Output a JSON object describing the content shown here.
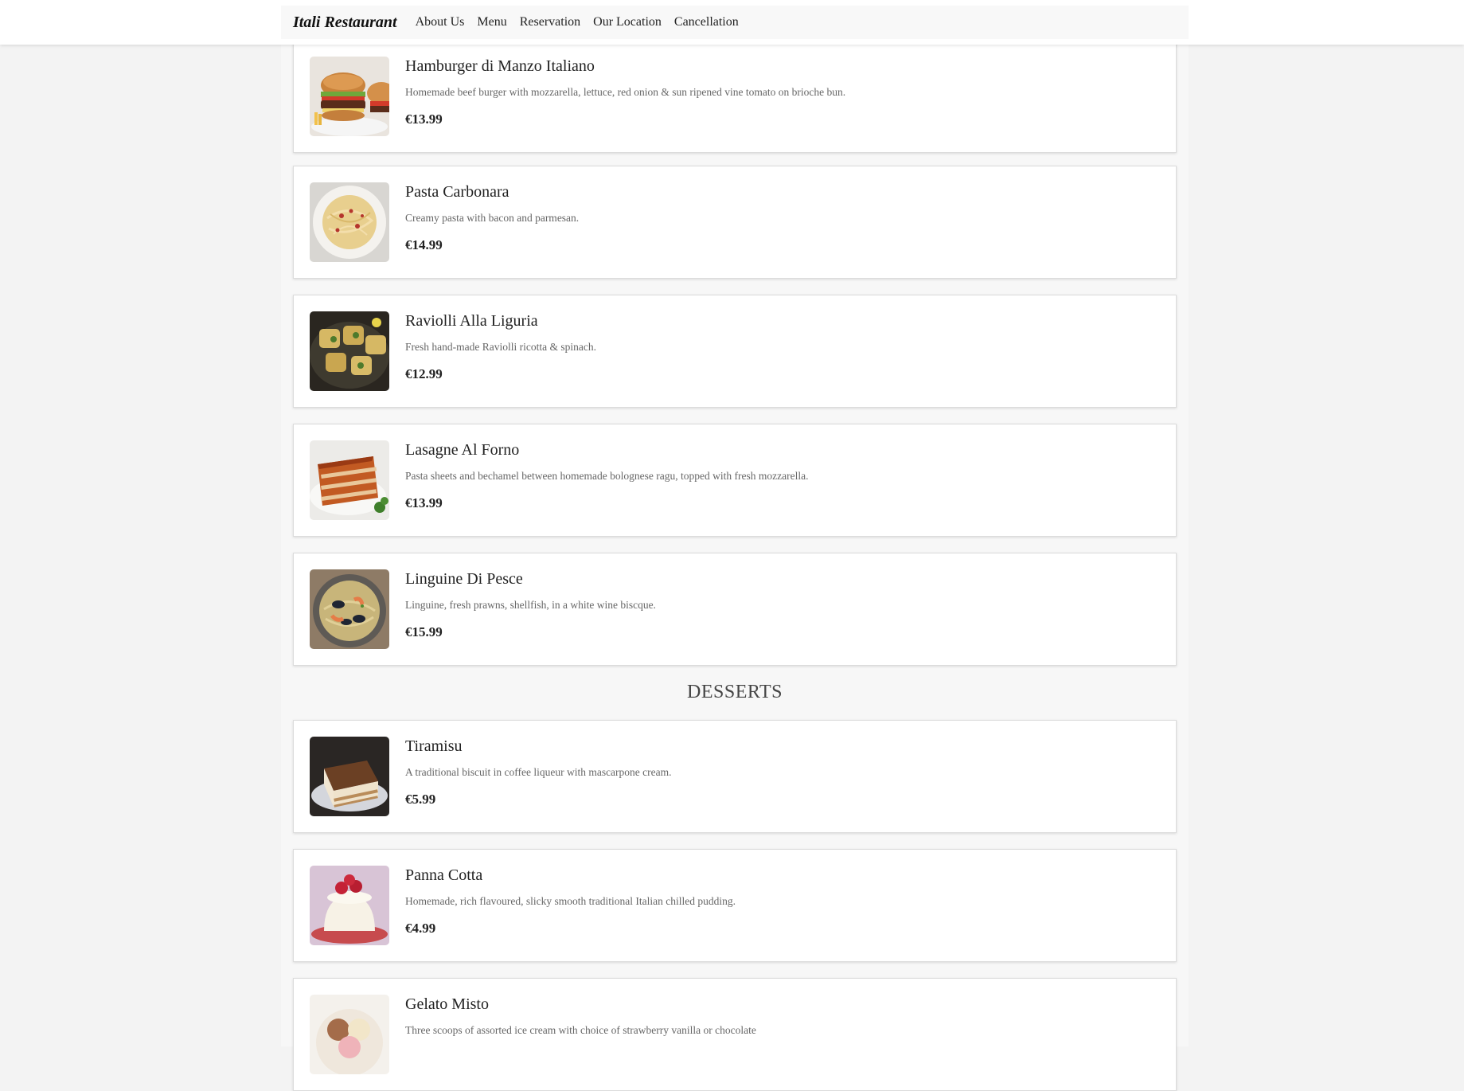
{
  "nav": {
    "brand": "Itali Restaurant",
    "links": [
      "About Us",
      "Menu",
      "Reservation",
      "Our Location",
      "Cancellation"
    ]
  },
  "mains": [
    {
      "name": "Hamburger di Manzo Italiano",
      "description": "Homemade beef burger with mozzarella, lettuce, red onion & sun ripened vine tomato on brioche bun.",
      "price": "€13.99",
      "image": "burger-image"
    },
    {
      "name": "Pasta Carbonara",
      "description": "Creamy pasta with bacon and parmesan.",
      "price": "€14.99",
      "image": "carbonara-image"
    },
    {
      "name": "Raviolli Alla Liguria",
      "description": "Fresh hand-made Raviolli ricotta & spinach.",
      "price": "€12.99",
      "image": "ravioli-image"
    },
    {
      "name": "Lasagne Al Forno",
      "description": "Pasta sheets and bechamel between homemade bolognese ragu, topped with fresh mozzarella.",
      "price": "€13.99",
      "image": "lasagne-image"
    },
    {
      "name": "Linguine Di Pesce",
      "description": "Linguine, fresh prawns, shellfish, in a white wine biscque.",
      "price": "€15.99",
      "image": "linguine-image"
    }
  ],
  "desserts_heading": "DESSERTS",
  "desserts": [
    {
      "name": "Tiramisu",
      "description": "A traditional biscuit in coffee liqueur with mascarpone cream.",
      "price": "€5.99",
      "image": "tiramisu-image"
    },
    {
      "name": "Panna Cotta",
      "description": "Homemade, rich flavoured, slicky smooth traditional Italian chilled pudding.",
      "price": "€4.99",
      "image": "panna-cotta-image"
    },
    {
      "name": "Gelato Misto",
      "description": "Three scoops of assorted ice cream with choice of strawberry vanilla or chocolate",
      "price": "",
      "image": "gelato-image"
    }
  ]
}
